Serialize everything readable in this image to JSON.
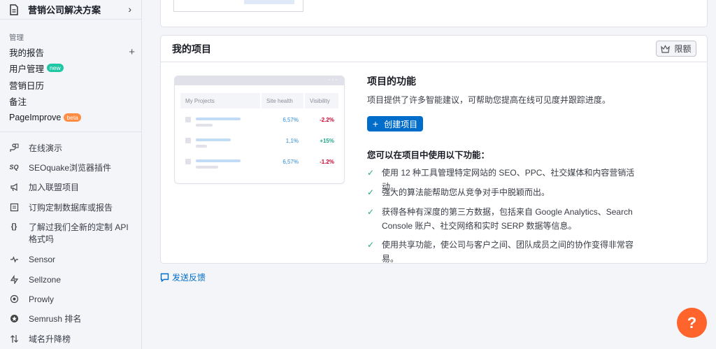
{
  "sidebar": {
    "top_item": "营销公司解决方案",
    "section_label": "管理",
    "items": [
      {
        "label": "我的报告",
        "badge": ""
      },
      {
        "label": "用户管理",
        "badge": "new"
      },
      {
        "label": "营销日历",
        "badge": ""
      },
      {
        "label": "备注",
        "badge": ""
      },
      {
        "label": "PageImprove",
        "badge": "beta"
      }
    ],
    "links": [
      {
        "icon": "presentation-icon",
        "label": "在线演示"
      },
      {
        "icon": "seoquake-icon",
        "icon_text": "SQ",
        "label": "SEOquake浏览器插件"
      },
      {
        "icon": "megaphone-icon",
        "label": "加入联盟项目"
      },
      {
        "icon": "document-list-icon",
        "label": "订购定制数据库或报告"
      },
      {
        "icon": "code-braces-icon",
        "icon_text": "{}",
        "label": "了解过我们全新的定制 API 格式吗"
      },
      {
        "icon": "sensor-icon",
        "label": "Sensor"
      },
      {
        "icon": "sellzone-icon",
        "label": "Sellzone"
      },
      {
        "icon": "prowly-icon",
        "label": "Prowly"
      },
      {
        "icon": "semrush-rank-icon",
        "label": "Semrush 排名"
      },
      {
        "icon": "domain-rank-icon",
        "label": "域名升降榜"
      }
    ]
  },
  "projects_card": {
    "title": "我的项目",
    "limit_button": "限额",
    "preview": {
      "headers": [
        "My Projects",
        "Site health",
        "Visibility"
      ],
      "rows": [
        {
          "health": "6,57%",
          "visibility": "-2.2%",
          "trend": "down"
        },
        {
          "health": "1,1%",
          "visibility": "+15%",
          "trend": "up"
        },
        {
          "health": "6,57%",
          "visibility": "-1.2%",
          "trend": "down"
        }
      ]
    },
    "features_title": "项目的功能",
    "features_desc": "项目提供了许多智能建议，可帮助您提高在线可见度并跟踪进度。",
    "create_button": "创建项目",
    "can_use_title": "您可以在项目中使用以下功能：",
    "features": [
      "使用 12 种工具管理特定网站的 SEO、PPC、社交媒体和内容营销活动。",
      "强大的算法能帮助您从竞争对手中脱颖而出。",
      "获得各种有深度的第三方数据，包括来自 Google Analytics、Search Console 账户、社交网络和实时 SERP 数据等信息。",
      "使用共享功能，使公司与客户之间、团队成员之间的协作变得非常容易。"
    ]
  },
  "feedback": "发送反馈",
  "help_button": "?",
  "colors": {
    "accent": "#006dca",
    "success": "#1fa888",
    "danger": "#d1002f",
    "help": "#ff642d"
  }
}
